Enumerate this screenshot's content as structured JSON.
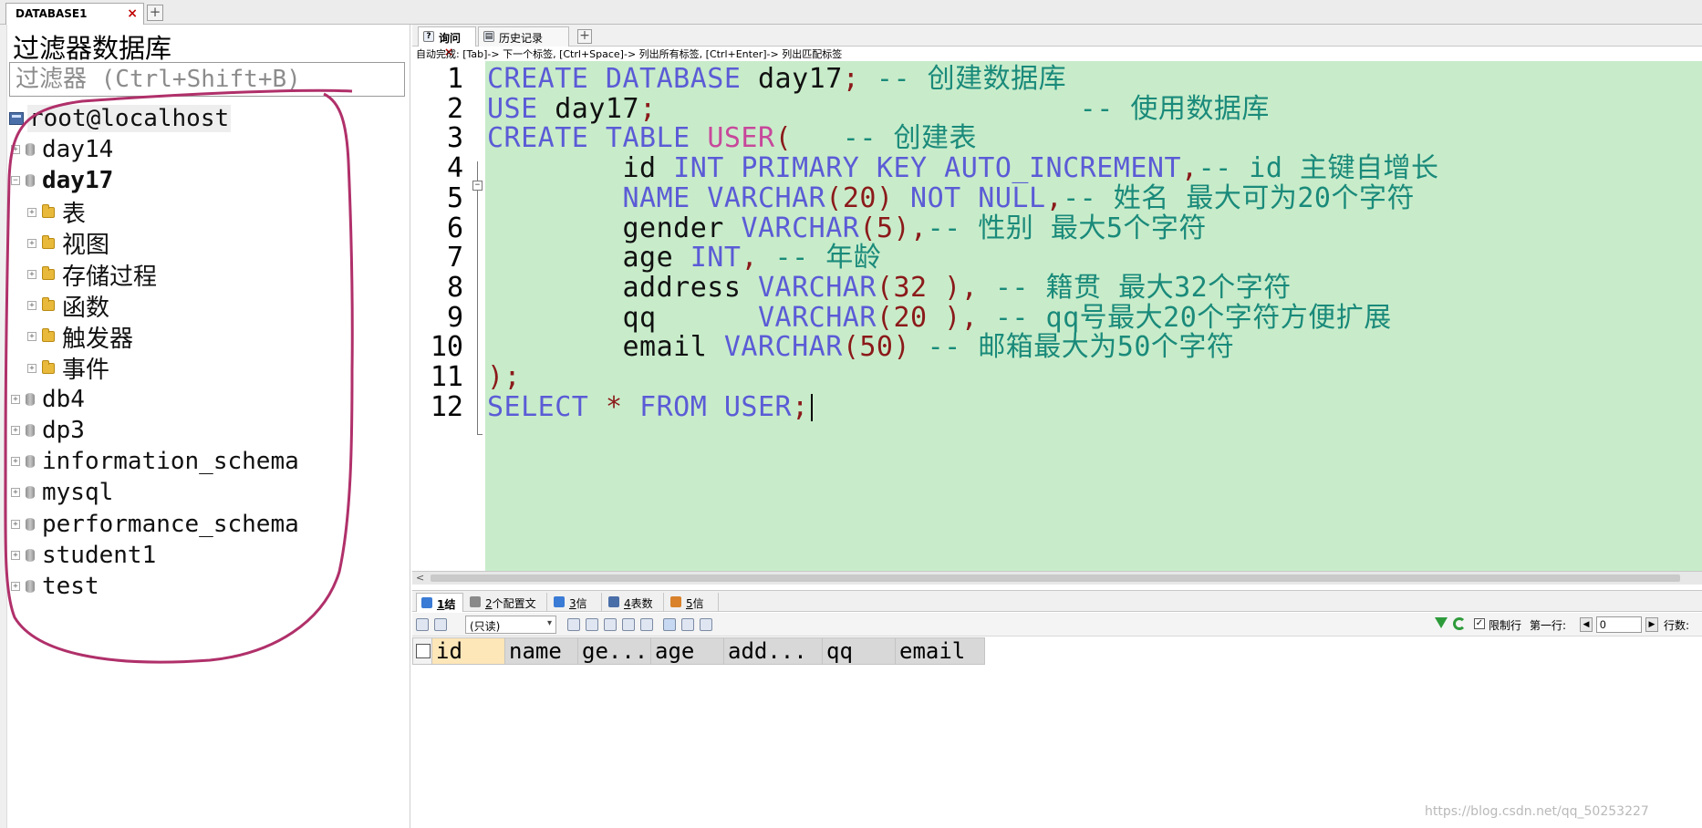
{
  "top_tab": {
    "label": "DATABASE1",
    "close": "×",
    "add": "+"
  },
  "left": {
    "filter_title": "过滤器数据库",
    "filter_placeholder": "过滤器 (Ctrl+Shift+B)",
    "root": "root@localhost",
    "tree": [
      {
        "label": "day14",
        "toggle": "+",
        "kind": "db",
        "level": 0
      },
      {
        "label": "day17",
        "toggle": "−",
        "kind": "db",
        "level": 0,
        "bold": true
      },
      {
        "label": "表",
        "toggle": "+",
        "kind": "folder",
        "level": 1
      },
      {
        "label": "视图",
        "toggle": "+",
        "kind": "folder",
        "level": 1
      },
      {
        "label": "存储过程",
        "toggle": "+",
        "kind": "folder",
        "level": 1
      },
      {
        "label": "函数",
        "toggle": "+",
        "kind": "folder",
        "level": 1
      },
      {
        "label": "触发器",
        "toggle": "+",
        "kind": "folder",
        "level": 1
      },
      {
        "label": "事件",
        "toggle": "+",
        "kind": "folder",
        "level": 1
      },
      {
        "label": "db4",
        "toggle": "+",
        "kind": "db",
        "level": 0
      },
      {
        "label": "dp3",
        "toggle": "+",
        "kind": "db",
        "level": 0
      },
      {
        "label": "information_schema",
        "toggle": "+",
        "kind": "db",
        "level": 0
      },
      {
        "label": "mysql",
        "toggle": "+",
        "kind": "db",
        "level": 0
      },
      {
        "label": "performance_schema",
        "toggle": "+",
        "kind": "db",
        "level": 0
      },
      {
        "label": "student1",
        "toggle": "+",
        "kind": "db",
        "level": 0
      },
      {
        "label": "test",
        "toggle": "+",
        "kind": "db",
        "level": 0
      }
    ],
    "annotation_color": "#b0306a"
  },
  "query_tabs": {
    "query": "询问",
    "query_close": "×",
    "history": "历史记录",
    "add": "+"
  },
  "hint": "自动完成: [Tab]-> 下一个标签, [Ctrl+Space]-> 列出所有标签, [Ctrl+Enter]-> 列出匹配标签",
  "editor": {
    "line_numbers": [
      "1",
      "2",
      "3",
      "4",
      "5",
      "6",
      "7",
      "8",
      "9",
      "10",
      "11",
      "12"
    ],
    "fold": "−",
    "background": "#c8ecca",
    "lines": [
      [
        [
          "kw",
          "CREATE DATABASE "
        ],
        [
          "id",
          "day17"
        ],
        [
          "pn",
          ";"
        ],
        [
          "cm",
          " -- 创建数据库"
        ]
      ],
      [
        [
          "kw",
          "USE "
        ],
        [
          "id",
          "day17"
        ],
        [
          "pn",
          ";"
        ],
        [
          "cm",
          "                         -- 使用数据库"
        ]
      ],
      [
        [
          "kw",
          "CREATE TABLE "
        ],
        [
          "fn",
          "USER"
        ],
        [
          "pn",
          "("
        ],
        [
          "cm",
          "   -- 创建表"
        ]
      ],
      [
        [
          "id",
          "        id "
        ],
        [
          "kw",
          "INT PRIMARY KEY AUTO_INCREMENT"
        ],
        [
          "pn",
          ","
        ],
        [
          "cm",
          "-- id 主键自增长"
        ]
      ],
      [
        [
          "id",
          "        "
        ],
        [
          "kw",
          "NAME VARCHAR"
        ],
        [
          "pn",
          "("
        ],
        [
          "nm",
          "20"
        ],
        [
          "pn",
          ")"
        ],
        [
          "kw",
          " NOT NULL"
        ],
        [
          "pn",
          ","
        ],
        [
          "cm",
          "-- 姓名 最大可为20个字符"
        ]
      ],
      [
        [
          "id",
          "        gender "
        ],
        [
          "kw",
          "VARCHAR"
        ],
        [
          "pn",
          "("
        ],
        [
          "nm",
          "5"
        ],
        [
          "pn",
          "),"
        ],
        [
          "cm",
          "-- 性别 最大5个字符"
        ]
      ],
      [
        [
          "id",
          "        age "
        ],
        [
          "kw",
          "INT"
        ],
        [
          "pn",
          ","
        ],
        [
          "cm",
          " -- 年龄"
        ]
      ],
      [
        [
          "id",
          "        address "
        ],
        [
          "kw",
          "VARCHAR"
        ],
        [
          "pn",
          "("
        ],
        [
          "nm",
          "32"
        ],
        [
          "pn",
          " ),"
        ],
        [
          "cm",
          " -- 籍贯 最大32个字符"
        ]
      ],
      [
        [
          "id",
          "        qq      "
        ],
        [
          "kw",
          "VARCHAR"
        ],
        [
          "pn",
          "("
        ],
        [
          "nm",
          "20"
        ],
        [
          "pn",
          " ),"
        ],
        [
          "cm",
          " -- qq号最大20个字符方便扩展"
        ]
      ],
      [
        [
          "id",
          "        email "
        ],
        [
          "kw",
          "VARCHAR"
        ],
        [
          "pn",
          "("
        ],
        [
          "nm",
          "50"
        ],
        [
          "pn",
          ")"
        ],
        [
          "cm",
          " -- 邮箱最大为50个字符"
        ]
      ],
      [
        [
          "pn",
          ");"
        ]
      ],
      [
        [
          "kw",
          "SELECT "
        ],
        [
          "pn",
          "* "
        ],
        [
          "kw",
          "FROM USER"
        ],
        [
          "pn",
          ";"
        ]
      ]
    ]
  },
  "scroll_left": "<",
  "result_tabs": [
    {
      "num": "1",
      "label": "结果",
      "color": "#3a7bd5"
    },
    {
      "num": "2",
      "label": "个配置文件",
      "color": "#8a8a8a"
    },
    {
      "num": "3",
      "label": "信息",
      "color": "#3a7bd5"
    },
    {
      "num": "4",
      "label": "表数据",
      "color": "#4a6ea8"
    },
    {
      "num": "5",
      "label": "信息",
      "color": "#d9822b"
    }
  ],
  "result_toolbar": {
    "readonly": "(只读)",
    "readonly_caret": "▾",
    "limit_check": "✓",
    "limit_label": "限制行",
    "first_row_label": "第一行:",
    "first_row_value": "0",
    "prev": "◀",
    "next": "▶",
    "rows_label": "行数:"
  },
  "grid_columns": [
    "id",
    "name",
    "ge...",
    "age",
    "add...",
    "qq",
    "email"
  ],
  "watermark": "https://blog.csdn.net/qq_50253227"
}
